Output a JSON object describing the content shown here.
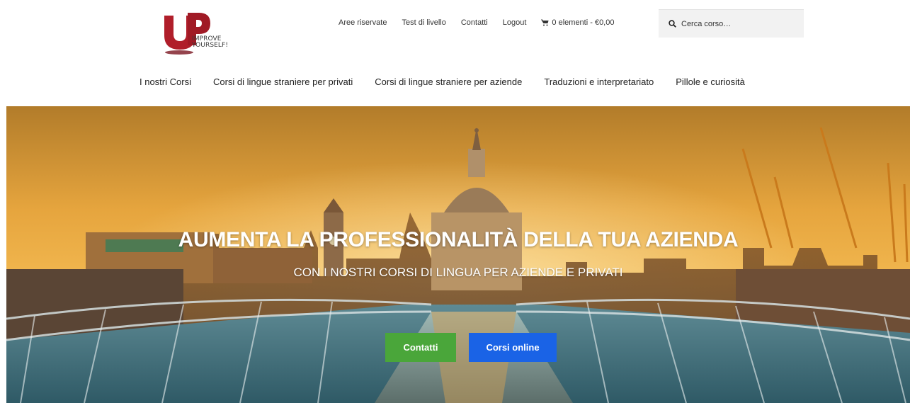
{
  "brand": {
    "logo_line1": "IMPROVE",
    "logo_line2": "YOURSELF!",
    "logo_colors": {
      "primary": "#b01e2a",
      "dark": "#5a0d12"
    }
  },
  "top_links": [
    {
      "label": "Aree riservate"
    },
    {
      "label": "Test di livello"
    },
    {
      "label": "Contatti"
    },
    {
      "label": "Logout"
    }
  ],
  "cart": {
    "icon": "cart-icon",
    "label": "0 elementi - €0,00"
  },
  "search": {
    "icon": "search-icon",
    "placeholder": "Cerca corso…",
    "value": ""
  },
  "main_nav": [
    {
      "label": "I nostri Corsi"
    },
    {
      "label": "Corsi di lingue straniere per privati"
    },
    {
      "label": "Corsi di lingue straniere per aziende"
    },
    {
      "label": "Traduzioni e interpretariato"
    },
    {
      "label": "Pillole e curiosità"
    }
  ],
  "hero": {
    "title": "AUMENTA LA PROFESSIONALITÀ DELLA TUA AZIENDA",
    "subtitle": "CON I NOSTRI CORSI DI LINGUA PER AZIENDE E PRIVATI",
    "buttons": [
      {
        "label": "Contatti",
        "color": "#4aa63a"
      },
      {
        "label": "Corsi online",
        "color": "#1a63e6"
      }
    ]
  }
}
